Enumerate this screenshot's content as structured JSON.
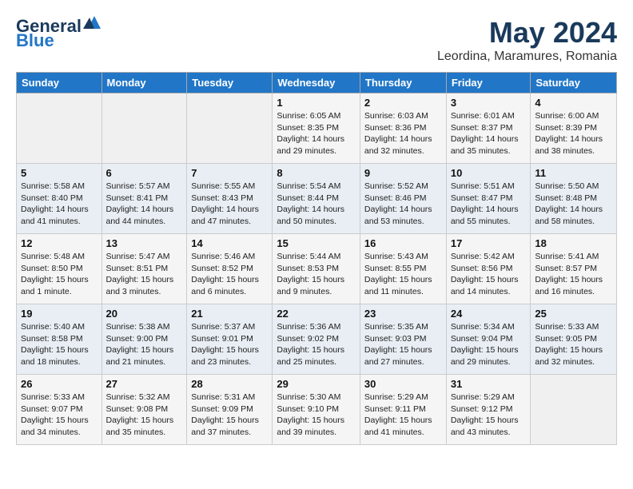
{
  "logo": {
    "general": "General",
    "blue": "Blue"
  },
  "title": {
    "month_year": "May 2024",
    "location": "Leordina, Maramures, Romania"
  },
  "weekdays": [
    "Sunday",
    "Monday",
    "Tuesday",
    "Wednesday",
    "Thursday",
    "Friday",
    "Saturday"
  ],
  "weeks": [
    [
      {
        "day": "",
        "info": ""
      },
      {
        "day": "",
        "info": ""
      },
      {
        "day": "",
        "info": ""
      },
      {
        "day": "1",
        "info": "Sunrise: 6:05 AM\nSunset: 8:35 PM\nDaylight: 14 hours\nand 29 minutes."
      },
      {
        "day": "2",
        "info": "Sunrise: 6:03 AM\nSunset: 8:36 PM\nDaylight: 14 hours\nand 32 minutes."
      },
      {
        "day": "3",
        "info": "Sunrise: 6:01 AM\nSunset: 8:37 PM\nDaylight: 14 hours\nand 35 minutes."
      },
      {
        "day": "4",
        "info": "Sunrise: 6:00 AM\nSunset: 8:39 PM\nDaylight: 14 hours\nand 38 minutes."
      }
    ],
    [
      {
        "day": "5",
        "info": "Sunrise: 5:58 AM\nSunset: 8:40 PM\nDaylight: 14 hours\nand 41 minutes."
      },
      {
        "day": "6",
        "info": "Sunrise: 5:57 AM\nSunset: 8:41 PM\nDaylight: 14 hours\nand 44 minutes."
      },
      {
        "day": "7",
        "info": "Sunrise: 5:55 AM\nSunset: 8:43 PM\nDaylight: 14 hours\nand 47 minutes."
      },
      {
        "day": "8",
        "info": "Sunrise: 5:54 AM\nSunset: 8:44 PM\nDaylight: 14 hours\nand 50 minutes."
      },
      {
        "day": "9",
        "info": "Sunrise: 5:52 AM\nSunset: 8:46 PM\nDaylight: 14 hours\nand 53 minutes."
      },
      {
        "day": "10",
        "info": "Sunrise: 5:51 AM\nSunset: 8:47 PM\nDaylight: 14 hours\nand 55 minutes."
      },
      {
        "day": "11",
        "info": "Sunrise: 5:50 AM\nSunset: 8:48 PM\nDaylight: 14 hours\nand 58 minutes."
      }
    ],
    [
      {
        "day": "12",
        "info": "Sunrise: 5:48 AM\nSunset: 8:50 PM\nDaylight: 15 hours\nand 1 minute."
      },
      {
        "day": "13",
        "info": "Sunrise: 5:47 AM\nSunset: 8:51 PM\nDaylight: 15 hours\nand 3 minutes."
      },
      {
        "day": "14",
        "info": "Sunrise: 5:46 AM\nSunset: 8:52 PM\nDaylight: 15 hours\nand 6 minutes."
      },
      {
        "day": "15",
        "info": "Sunrise: 5:44 AM\nSunset: 8:53 PM\nDaylight: 15 hours\nand 9 minutes."
      },
      {
        "day": "16",
        "info": "Sunrise: 5:43 AM\nSunset: 8:55 PM\nDaylight: 15 hours\nand 11 minutes."
      },
      {
        "day": "17",
        "info": "Sunrise: 5:42 AM\nSunset: 8:56 PM\nDaylight: 15 hours\nand 14 minutes."
      },
      {
        "day": "18",
        "info": "Sunrise: 5:41 AM\nSunset: 8:57 PM\nDaylight: 15 hours\nand 16 minutes."
      }
    ],
    [
      {
        "day": "19",
        "info": "Sunrise: 5:40 AM\nSunset: 8:58 PM\nDaylight: 15 hours\nand 18 minutes."
      },
      {
        "day": "20",
        "info": "Sunrise: 5:38 AM\nSunset: 9:00 PM\nDaylight: 15 hours\nand 21 minutes."
      },
      {
        "day": "21",
        "info": "Sunrise: 5:37 AM\nSunset: 9:01 PM\nDaylight: 15 hours\nand 23 minutes."
      },
      {
        "day": "22",
        "info": "Sunrise: 5:36 AM\nSunset: 9:02 PM\nDaylight: 15 hours\nand 25 minutes."
      },
      {
        "day": "23",
        "info": "Sunrise: 5:35 AM\nSunset: 9:03 PM\nDaylight: 15 hours\nand 27 minutes."
      },
      {
        "day": "24",
        "info": "Sunrise: 5:34 AM\nSunset: 9:04 PM\nDaylight: 15 hours\nand 29 minutes."
      },
      {
        "day": "25",
        "info": "Sunrise: 5:33 AM\nSunset: 9:05 PM\nDaylight: 15 hours\nand 32 minutes."
      }
    ],
    [
      {
        "day": "26",
        "info": "Sunrise: 5:33 AM\nSunset: 9:07 PM\nDaylight: 15 hours\nand 34 minutes."
      },
      {
        "day": "27",
        "info": "Sunrise: 5:32 AM\nSunset: 9:08 PM\nDaylight: 15 hours\nand 35 minutes."
      },
      {
        "day": "28",
        "info": "Sunrise: 5:31 AM\nSunset: 9:09 PM\nDaylight: 15 hours\nand 37 minutes."
      },
      {
        "day": "29",
        "info": "Sunrise: 5:30 AM\nSunset: 9:10 PM\nDaylight: 15 hours\nand 39 minutes."
      },
      {
        "day": "30",
        "info": "Sunrise: 5:29 AM\nSunset: 9:11 PM\nDaylight: 15 hours\nand 41 minutes."
      },
      {
        "day": "31",
        "info": "Sunrise: 5:29 AM\nSunset: 9:12 PM\nDaylight: 15 hours\nand 43 minutes."
      },
      {
        "day": "",
        "info": ""
      }
    ]
  ]
}
